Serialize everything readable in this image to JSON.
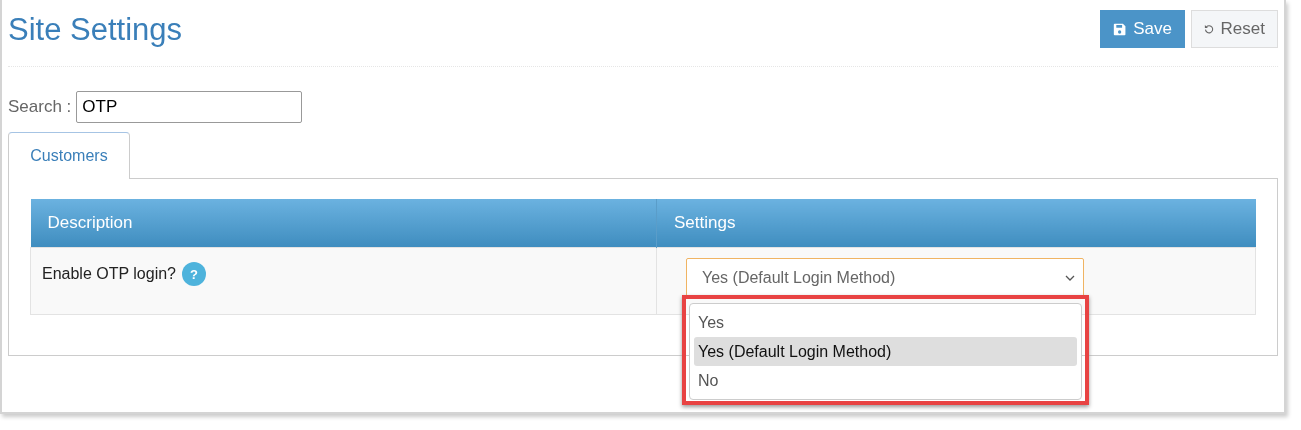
{
  "page": {
    "title": "Site Settings"
  },
  "buttons": [
    {
      "kind": "save",
      "label": "Save"
    },
    {
      "kind": "reset",
      "label": "Reset"
    }
  ],
  "search": {
    "label": "Search :",
    "value": "OTP"
  },
  "tabs": [
    {
      "label": "Customers",
      "selected": true
    }
  ],
  "table": {
    "columns": [
      "Description",
      "Settings"
    ],
    "rows": [
      {
        "description": "Enable OTP login?",
        "help": "?",
        "value": "Yes (Default Login Method)",
        "open": true,
        "highlighted": true,
        "options": [
          {
            "label": "Yes",
            "selected": false
          },
          {
            "label": "Yes (Default Login Method)",
            "selected": true
          },
          {
            "label": "No",
            "selected": false
          }
        ]
      }
    ]
  }
}
